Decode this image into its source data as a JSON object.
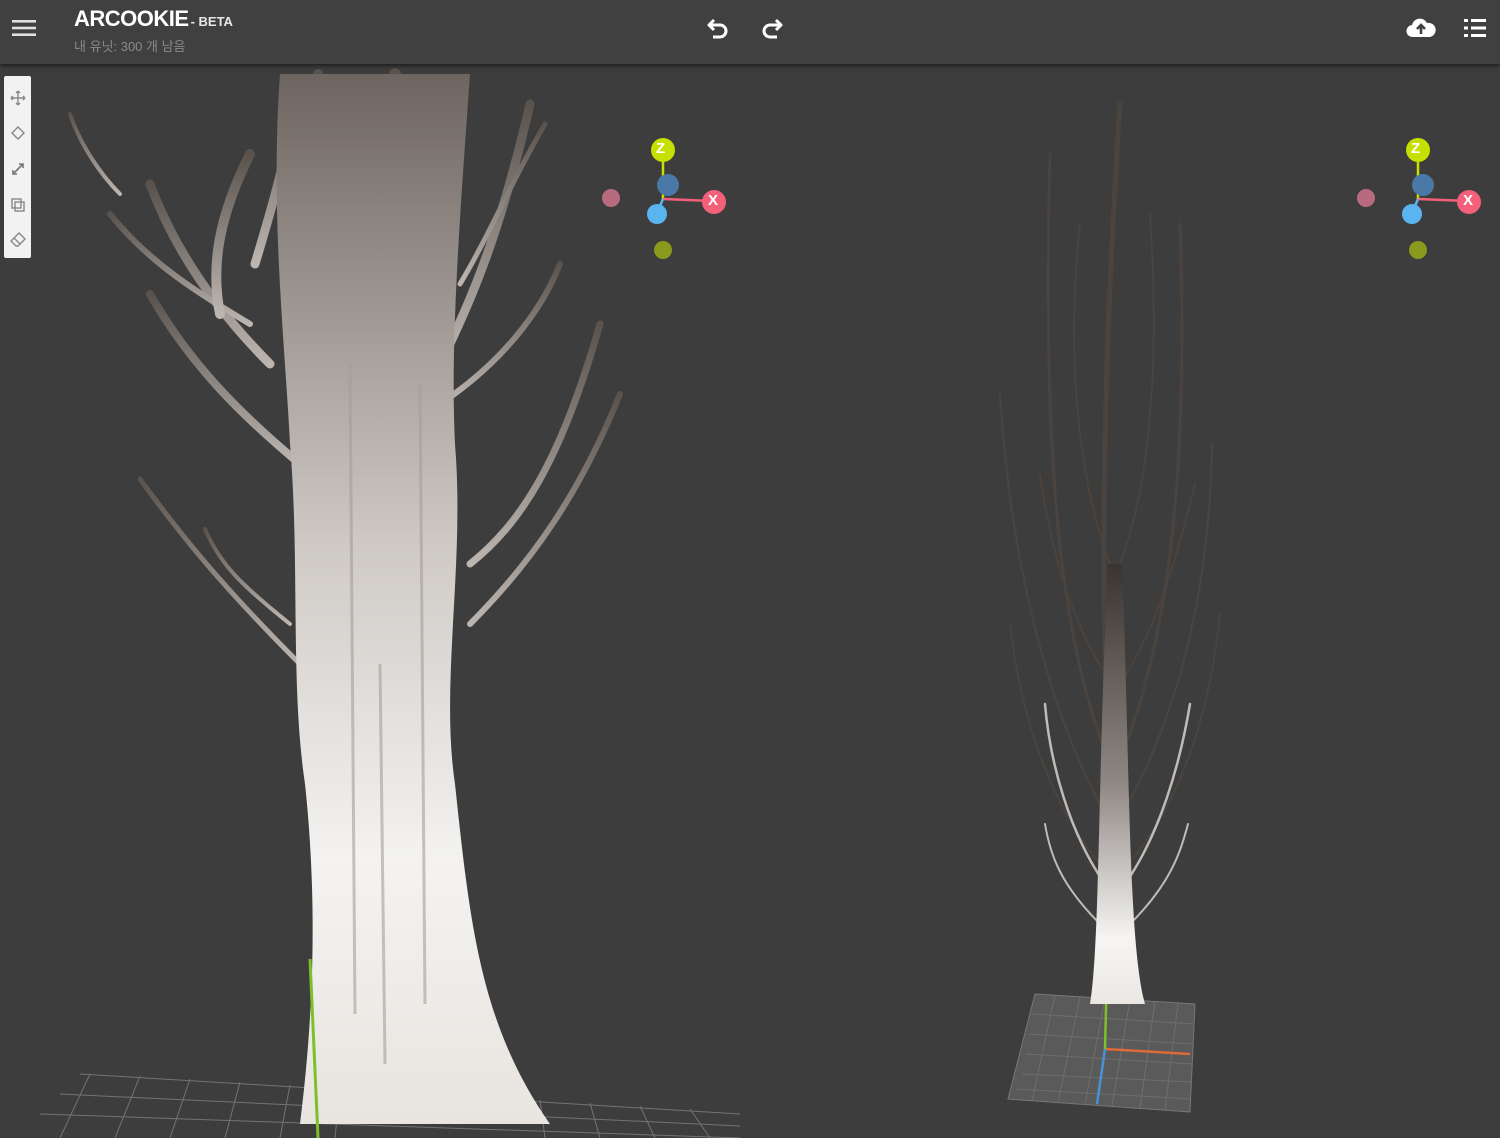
{
  "app": {
    "title": "ARCOOKIE",
    "beta": "- BETA",
    "subtitle": "내 유닛: 300 개 남음"
  },
  "icons": {
    "menu": "hamburger-menu-icon",
    "undo": "undo-icon",
    "redo": "redo-icon",
    "upload": "cloud-upload-icon",
    "list": "list-icon"
  },
  "tools": [
    "move-icon",
    "rotate-icon",
    "scale-icon",
    "duplicate-icon",
    "eraser-icon"
  ],
  "gizmo": {
    "z_label": "Z",
    "x_label": "X",
    "colors": {
      "z": "#c6e000",
      "x": "#f2607a",
      "y": "#5ab4f0",
      "center": "#4a79a8",
      "neg_x": "#b86a7e",
      "neg_z": "#8a9a1c"
    }
  },
  "colors": {
    "background": "#3d3d3d",
    "topbar": "#404040",
    "toolbox": "#f2f2f2"
  }
}
